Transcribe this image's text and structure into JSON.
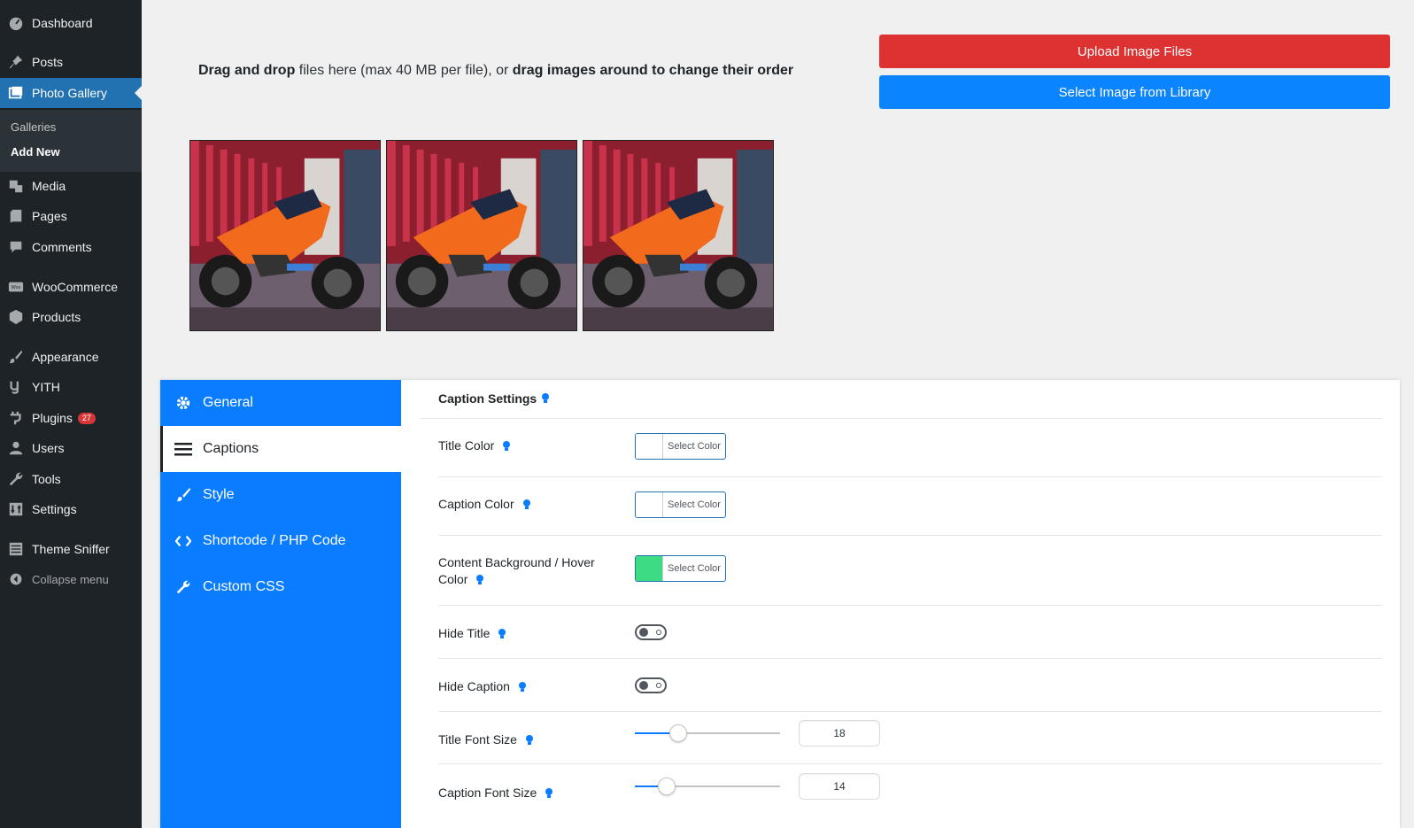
{
  "sidebar": {
    "items": [
      {
        "label": "Dashboard",
        "icon": "dashboard-icon"
      },
      {
        "label": "Posts",
        "icon": "pin-icon"
      },
      {
        "label": "Photo Gallery",
        "icon": "gallery-icon",
        "active": true
      },
      {
        "label": "Media",
        "icon": "media-icon"
      },
      {
        "label": "Pages",
        "icon": "pages-icon"
      },
      {
        "label": "Comments",
        "icon": "comments-icon"
      },
      {
        "label": "WooCommerce",
        "icon": "woo-icon"
      },
      {
        "label": "Products",
        "icon": "products-icon"
      },
      {
        "label": "Appearance",
        "icon": "brush-icon"
      },
      {
        "label": "YITH",
        "icon": "yith-icon"
      },
      {
        "label": "Plugins",
        "icon": "plugin-icon",
        "badge": "27"
      },
      {
        "label": "Users",
        "icon": "user-icon"
      },
      {
        "label": "Tools",
        "icon": "wrench-icon"
      },
      {
        "label": "Settings",
        "icon": "settings-icon"
      },
      {
        "label": "Theme Sniffer",
        "icon": "list-icon"
      }
    ],
    "submenu": [
      "Galleries",
      "Add New"
    ],
    "collapse_label": "Collapse menu"
  },
  "upload": {
    "drag_bold_1": "Drag and drop",
    "drag_text_1": " files here (max 40 MB per file), or ",
    "drag_bold_2": "drag images around to change their order",
    "upload_button": "Upload Image Files",
    "library_button": "Select Image from Library"
  },
  "thumbnails": [
    "motorcycle photo",
    "motorcycle photo",
    "motorcycle photo"
  ],
  "tabs": [
    {
      "label": "General",
      "icon": "gear-icon"
    },
    {
      "label": "Captions",
      "icon": "menu-lines-icon",
      "active": true
    },
    {
      "label": "Style",
      "icon": "brush-icon"
    },
    {
      "label": "Shortcode / PHP Code",
      "icon": "code-icon"
    },
    {
      "label": "Custom CSS",
      "icon": "wrench-icon"
    }
  ],
  "panel": {
    "heading": "Caption Settings",
    "rows": {
      "title_color": {
        "label": "Title Color",
        "button": "Select Color",
        "color": "#ffffff"
      },
      "caption_color": {
        "label": "Caption Color",
        "button": "Select Color",
        "color": "#ffffff"
      },
      "content_bg": {
        "label_1": "Content Background / Hover",
        "label_2": "Color",
        "button": "Select Color",
        "color": "#3ddc84"
      },
      "hide_title": {
        "label": "Hide Title",
        "checked": false
      },
      "hide_caption": {
        "label": "Hide Caption",
        "checked": false
      },
      "title_font_size": {
        "label": "Title Font Size",
        "value": "18",
        "slider_fraction": 0.3
      },
      "caption_font_size": {
        "label": "Caption Font Size",
        "value": "14",
        "slider_fraction": 0.22
      }
    }
  },
  "colors": {
    "accent_blue": "#0a7cff",
    "upload_red": "#dc3232",
    "hint_icon": "#0a7cff"
  }
}
